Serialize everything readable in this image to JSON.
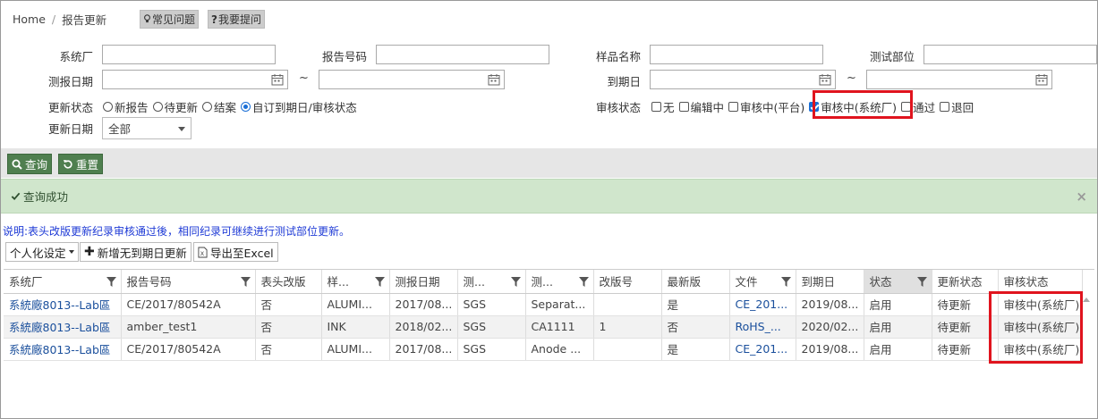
{
  "breadcrumb": {
    "home": "Home",
    "separator": "/",
    "current": "报告更新"
  },
  "help_buttons": {
    "faq": "常见问题",
    "ask": "我要提问"
  },
  "form": {
    "system_factory": {
      "label": "系统厂",
      "value": ""
    },
    "report_no": {
      "label": "报告号码",
      "value": ""
    },
    "sample_name": {
      "label": "样品名称",
      "value": ""
    },
    "test_part": {
      "label": "测试部位",
      "value": ""
    },
    "report_date": {
      "label": "测报日期",
      "from": "",
      "to": ""
    },
    "due_date": {
      "label": "到期日",
      "from": "",
      "to": ""
    },
    "range_sep": "~",
    "update_status": {
      "label": "更新状态",
      "options": [
        "新报告",
        "待更新",
        "结案",
        "自订到期日/审核状态"
      ],
      "selected_index": 3
    },
    "review_status": {
      "label": "审核状态",
      "options": [
        {
          "label": "无",
          "checked": false
        },
        {
          "label": "编辑中",
          "checked": false
        },
        {
          "label": "审核中(平台)",
          "checked": false
        },
        {
          "label": "审核中(系统厂)",
          "checked": true
        },
        {
          "label": "通过",
          "checked": false
        },
        {
          "label": "退回",
          "checked": false
        }
      ]
    },
    "update_date": {
      "label": "更新日期",
      "selected": "全部"
    }
  },
  "actions": {
    "query": "查询",
    "reset": "重置"
  },
  "alert": {
    "message": "查询成功",
    "close": "×"
  },
  "note": "说明:表头改版更新纪录审核通过後，相同纪录可继续进行测试部位更新。",
  "toolbar": {
    "personalize": "个人化设定",
    "add_no_due": "新增无到期日更新",
    "export": "导出至Excel"
  },
  "table": {
    "columns": [
      "系统厂",
      "报告号码",
      "表头改版",
      "样...",
      "测报日期",
      "测...",
      "测...",
      "改版号",
      "最新版",
      "文件",
      "到期日",
      "状态",
      "更新状态",
      "审核状态"
    ],
    "rows": [
      [
        "系統廠8013--Lab區",
        "CE/2017/80542A",
        "否",
        "ALUMI...",
        "2017/08...",
        "SGS",
        "Separat...",
        "",
        "是",
        "CE_201...",
        "2019/08...",
        "启用",
        "待更新",
        "审核中(系统厂)"
      ],
      [
        "系統廠8013--Lab區",
        "amber_test1",
        "否",
        "INK",
        "2018/02...",
        "SGS",
        "CA1111",
        "1",
        "否",
        "RoHS_...",
        "2020/02...",
        "启用",
        "待更新",
        "审核中(系统厂)"
      ],
      [
        "系統廠8013--Lab區",
        "CE/2017/80542A",
        "否",
        "ALUMI...",
        "2017/08...",
        "SGS",
        "Anode ...",
        "",
        "是",
        "CE_201...",
        "2019/08...",
        "启用",
        "待更新",
        "审核中(系统厂)"
      ]
    ]
  },
  "colors": {
    "accent": "#4f7f4f",
    "highlight": "#e0141e",
    "link": "#1a4f9c",
    "note": "#1f3bd6",
    "alert_bg": "#d0e6cc"
  },
  "icons": [
    "lightbulb-icon",
    "question-icon",
    "calendar-icon",
    "search-icon",
    "refresh-icon",
    "check-icon",
    "plus-icon",
    "excel-icon",
    "filter-icon",
    "scroll-up-icon"
  ]
}
